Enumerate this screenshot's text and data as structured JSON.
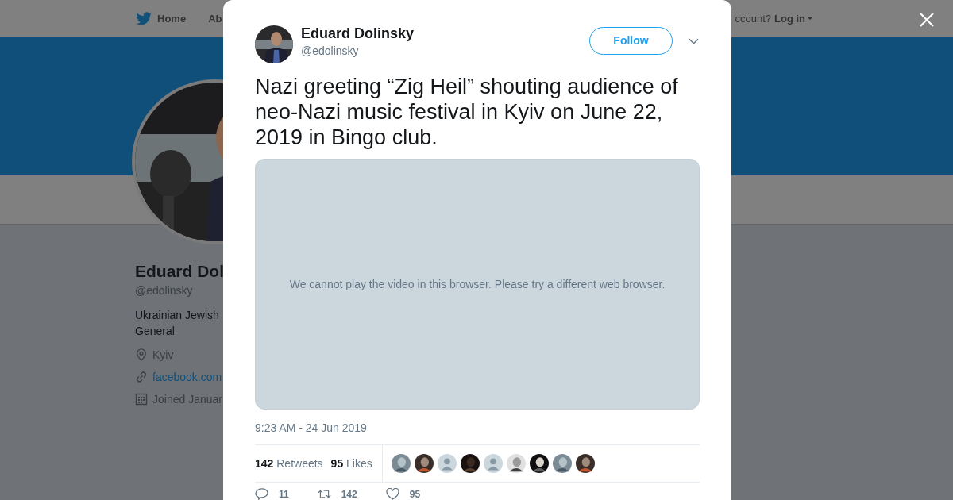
{
  "background_page": {
    "nav": {
      "items": [
        "Home",
        "Ab"
      ],
      "account_prompt": "ccount?",
      "login": "Log in"
    },
    "profile": {
      "name": "Eduard Dol",
      "handle": "@edolinsky",
      "bio": [
        "Ukrainian Jewish",
        "General"
      ],
      "location": "Kyiv",
      "link": "facebook.com",
      "joined": "Joined Januar"
    }
  },
  "tweet_modal": {
    "author": {
      "name": "Eduard Dolinsky",
      "handle": "@edolinsky"
    },
    "follow_button": "Follow",
    "text": "Nazi greeting “Zig Heil” shouting audience of neo-Nazi music festival in Kyiv on June 22, 2019 in Bingo club.",
    "video_message": "We cannot play the video in this browser. Please try a different web browser.",
    "timestamp": "9:23 AM - 24 Jun 2019",
    "stats": [
      {
        "count": "142",
        "label": "Retweets"
      },
      {
        "count": "95",
        "label": "Likes"
      }
    ],
    "liker_avatars": [
      {
        "kind": "picture"
      },
      {
        "kind": "picture"
      },
      {
        "kind": "default"
      },
      {
        "kind": "picture"
      },
      {
        "kind": "default"
      },
      {
        "kind": "picture"
      },
      {
        "kind": "picture"
      },
      {
        "kind": "picture"
      },
      {
        "kind": "picture"
      }
    ],
    "actions": [
      {
        "kind": "reply",
        "count": "11"
      },
      {
        "kind": "retweet",
        "count": "142"
      },
      {
        "kind": "like",
        "count": "95"
      }
    ]
  }
}
